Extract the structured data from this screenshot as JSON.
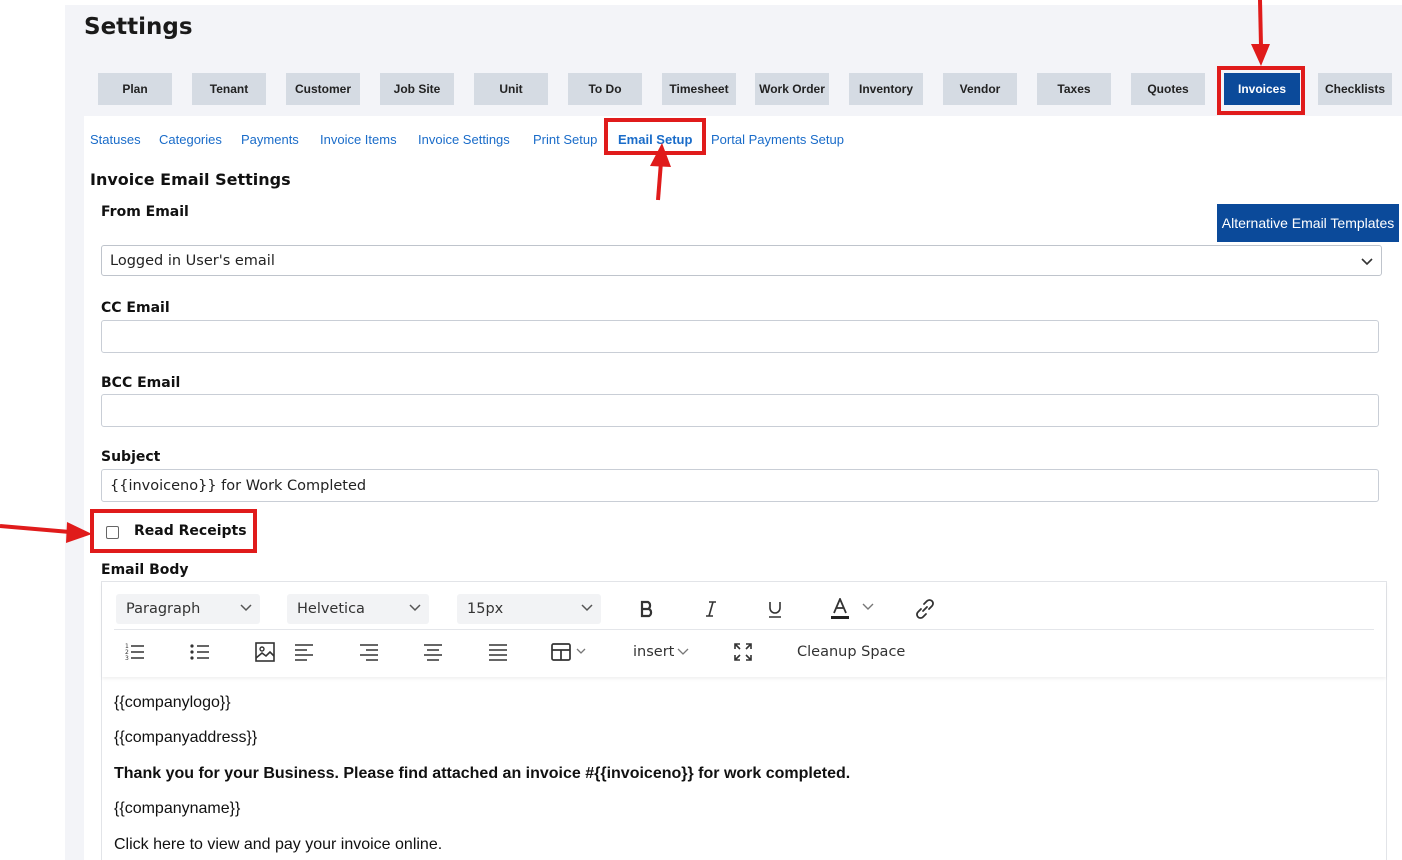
{
  "page_title": "Settings",
  "top_tabs": [
    {
      "label": "Plan"
    },
    {
      "label": "Tenant"
    },
    {
      "label": "Customer"
    },
    {
      "label": "Job Site"
    },
    {
      "label": "Unit"
    },
    {
      "label": "To Do"
    },
    {
      "label": "Timesheet"
    },
    {
      "label": "Work Order"
    },
    {
      "label": "Inventory"
    },
    {
      "label": "Vendor"
    },
    {
      "label": "Taxes"
    },
    {
      "label": "Quotes"
    },
    {
      "label": "Invoices",
      "active": true
    },
    {
      "label": "Checklists"
    }
  ],
  "sub_nav": [
    {
      "label": "Statuses"
    },
    {
      "label": "Categories"
    },
    {
      "label": "Payments"
    },
    {
      "label": "Invoice Items"
    },
    {
      "label": "Invoice Settings"
    },
    {
      "label": "Print Setup"
    },
    {
      "label": "Email Setup",
      "active": true
    },
    {
      "label": "Portal Payments Setup"
    }
  ],
  "section_title": "Invoice Email Settings",
  "alt_templates_button": "Alternative Email Templates",
  "from_email": {
    "label": "From Email",
    "value": "Logged in User's email"
  },
  "cc_email": {
    "label": "CC Email",
    "value": ""
  },
  "bcc_email": {
    "label": "BCC Email",
    "value": ""
  },
  "subject": {
    "label": "Subject",
    "value": "{{invoiceno}} for Work Completed"
  },
  "read_receipts": {
    "label": "Read Receipts",
    "checked": false
  },
  "email_body": {
    "label": "Email Body",
    "toolbar": {
      "block_format": "Paragraph",
      "font_family": "Helvetica",
      "font_size": "15px",
      "insert_label": "insert",
      "cleanup_label": "Cleanup Space"
    },
    "lines": [
      "{{companylogo}}",
      "{{companyaddress}}",
      "Thank you for your Business. Please find attached an invoice #{{invoiceno}} for work completed.",
      "{{companyname}}",
      "Click here to view and pay your invoice online."
    ]
  },
  "colors": {
    "accent": "#0b4a9a",
    "link": "#1a6cc9",
    "annotation": "#e01b1b"
  }
}
